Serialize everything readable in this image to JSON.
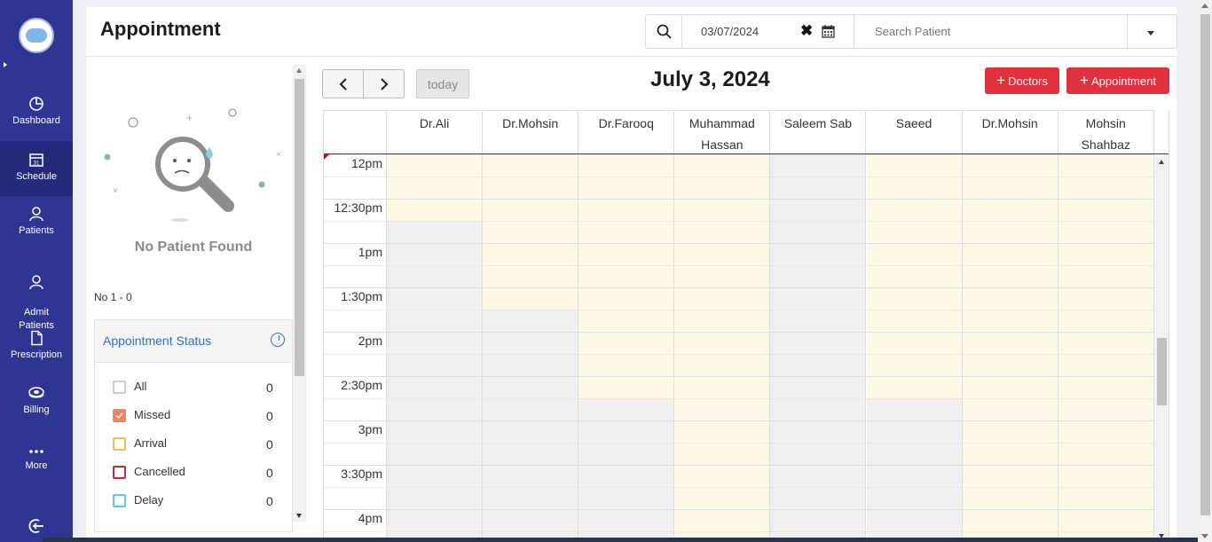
{
  "sidebar": {
    "items": [
      {
        "label": "Dashboard",
        "icon": "dashboard-icon"
      },
      {
        "label": "Schedule",
        "icon": "calendar-icon",
        "active": true
      },
      {
        "label": "Patients",
        "icon": "user-icon"
      },
      {
        "label": "Admit\nPatients",
        "icon": "user-icon"
      },
      {
        "label": "Prescription",
        "icon": "document-icon"
      },
      {
        "label": "Billing",
        "icon": "money-icon"
      },
      {
        "label": "More",
        "icon": "more-dots-icon"
      }
    ],
    "logout_icon": "logout-icon"
  },
  "header": {
    "title": "Appointment",
    "date_value": "03/07/2024",
    "search_placeholder": "Search Patient"
  },
  "left_panel": {
    "empty_text": "No Patient Found",
    "count_text": "No 1 - 0",
    "status_title": "Appointment Status",
    "statuses": [
      {
        "label": "All",
        "count": "0",
        "checked": false,
        "color": "#cfcfcf"
      },
      {
        "label": "Missed",
        "count": "0",
        "checked": true,
        "color": "#f0875a"
      },
      {
        "label": "Arrival",
        "count": "0",
        "checked": false,
        "color": "#f5c045"
      },
      {
        "label": "Cancelled",
        "count": "0",
        "checked": false,
        "color": "#d22b2b"
      },
      {
        "label": "Delay",
        "count": "0",
        "checked": false,
        "color": "#5bc8f0"
      }
    ]
  },
  "calendar": {
    "today_label": "today",
    "title": "July 3, 2024",
    "doctors_button": "Doctors",
    "appointment_button": "Appointment",
    "columns": [
      {
        "name": "Dr.Ali",
        "available_to": 1.5
      },
      {
        "name": "Dr.Mohsin",
        "available_to": 3.5
      },
      {
        "name": "Dr.Farooq",
        "available_to": 5.5
      },
      {
        "name": "Muhammad\nHassan",
        "available_to": 99
      },
      {
        "name": "Saleem Sab",
        "available_to": 0
      },
      {
        "name": "Saeed",
        "available_to": 5.5
      },
      {
        "name": "Dr.Mohsin",
        "available_to": 99
      },
      {
        "name": "Mohsin\nShahbaz",
        "available_to": 99
      }
    ],
    "times": [
      "12pm",
      "12:30pm",
      "1pm",
      "1:30pm",
      "2pm",
      "2:30pm",
      "3pm",
      "3:30pm",
      "4pm"
    ],
    "colors": {
      "available": "#fdf8e4",
      "unavailable": "#efefef",
      "now_line": "#e00000",
      "brand": "#2e3592",
      "accent_red": "#e1323e"
    }
  }
}
